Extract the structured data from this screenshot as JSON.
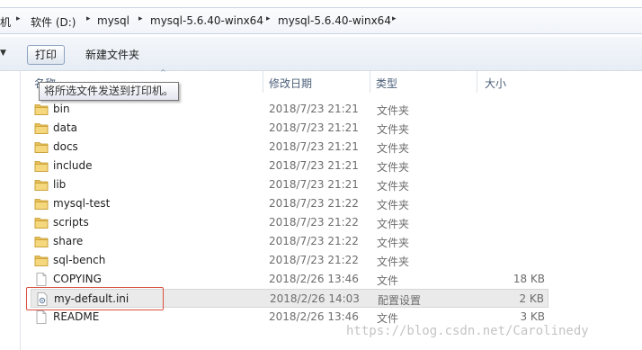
{
  "breadcrumb": {
    "items": [
      "机",
      "软件 (D:)",
      "mysql",
      "mysql-5.6.40-winx64",
      "mysql-5.6.40-winx64"
    ],
    "separator": "▸"
  },
  "toolbar": {
    "overflow_arrow": "▼",
    "print_label": "打印",
    "new_folder_label": "新建文件夹"
  },
  "columns": {
    "name": "名称",
    "date": "修改日期",
    "type": "类型",
    "size": "大小",
    "sort_indicator": "^"
  },
  "tooltip": "将所选文件发送到打印机。",
  "files": [
    {
      "name": "bin",
      "date": "2018/7/23 21:21",
      "type": "文件夹",
      "size": "",
      "icon": "folder-icon"
    },
    {
      "name": "data",
      "date": "2018/7/23 21:21",
      "type": "文件夹",
      "size": "",
      "icon": "folder-icon"
    },
    {
      "name": "docs",
      "date": "2018/7/23 21:21",
      "type": "文件夹",
      "size": "",
      "icon": "folder-icon"
    },
    {
      "name": "include",
      "date": "2018/7/23 21:21",
      "type": "文件夹",
      "size": "",
      "icon": "folder-icon"
    },
    {
      "name": "lib",
      "date": "2018/7/23 21:21",
      "type": "文件夹",
      "size": "",
      "icon": "folder-icon"
    },
    {
      "name": "mysql-test",
      "date": "2018/7/23 21:22",
      "type": "文件夹",
      "size": "",
      "icon": "folder-icon"
    },
    {
      "name": "scripts",
      "date": "2018/7/23 21:22",
      "type": "文件夹",
      "size": "",
      "icon": "folder-icon"
    },
    {
      "name": "share",
      "date": "2018/7/23 21:22",
      "type": "文件夹",
      "size": "",
      "icon": "folder-icon"
    },
    {
      "name": "sql-bench",
      "date": "2018/7/23 21:22",
      "type": "文件夹",
      "size": "",
      "icon": "folder-icon"
    },
    {
      "name": "COPYING",
      "date": "2018/2/26 13:46",
      "type": "文件",
      "size": "18 KB",
      "icon": "file-icon"
    },
    {
      "name": "my-default.ini",
      "date": "2018/2/26 14:03",
      "type": "配置设置",
      "size": "2 KB",
      "icon": "config-file-icon",
      "selected": true
    },
    {
      "name": "README",
      "date": "2018/2/26 13:46",
      "type": "文件",
      "size": "3 KB",
      "icon": "file-icon"
    }
  ],
  "colors": {
    "highlight_box": "#d95040",
    "folder": "#e8c05a",
    "selection": "#eaeaea"
  },
  "watermark": "https://blog.csdn.net/Carolinedy"
}
